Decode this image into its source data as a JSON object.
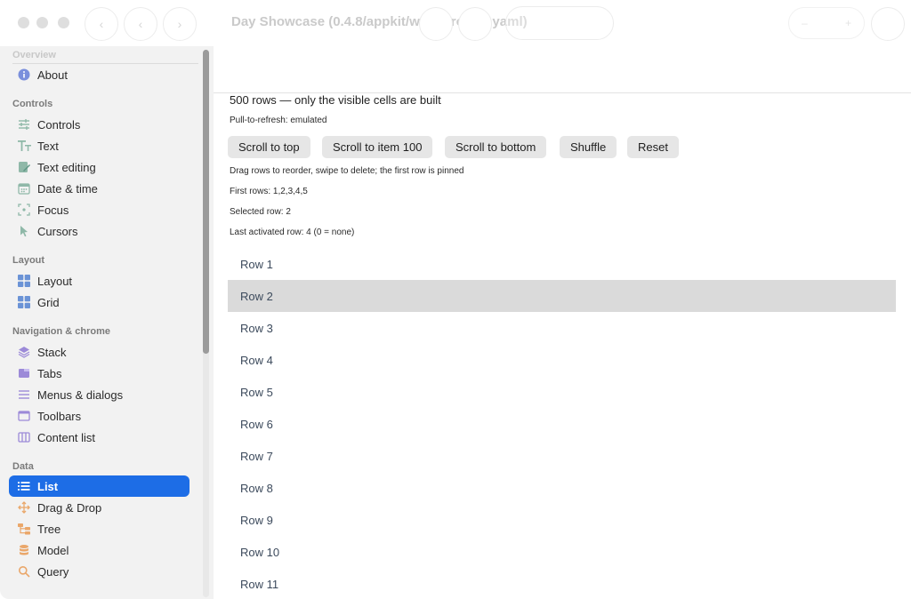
{
  "window": {
    "title": "Day Showcase (0.4.8/appkit/walkthrough.yaml)",
    "nav_back_icon": "chevron-left-icon",
    "nav_forward_icon": "chevron-right-icon"
  },
  "sidebar": {
    "overview_heading": "Overview",
    "items_overview": [
      {
        "label": "About",
        "icon": "info-icon",
        "color": "#7a8fdc"
      }
    ],
    "controls_heading": "Controls",
    "items_controls": [
      {
        "label": "Controls",
        "icon": "sliders-icon",
        "color": "#8fb8a8"
      },
      {
        "label": "Text",
        "icon": "text-size-icon",
        "color": "#8fb8a8"
      },
      {
        "label": "Text editing",
        "icon": "pencil-icon",
        "color": "#8fb8a8"
      },
      {
        "label": "Date & time",
        "icon": "calendar-icon",
        "color": "#8fb8a8"
      },
      {
        "label": "Focus",
        "icon": "focus-icon",
        "color": "#8fb8a8"
      },
      {
        "label": "Cursors",
        "icon": "cursor-icon",
        "color": "#8fb8a8"
      }
    ],
    "layout_heading": "Layout",
    "items_layout": [
      {
        "label": "Layout",
        "icon": "layout-icon",
        "color": "#6b93d6"
      },
      {
        "label": "Grid",
        "icon": "grid-icon",
        "color": "#6b93d6"
      }
    ],
    "navigation_heading": "Navigation & chrome",
    "items_navigation": [
      {
        "label": "Stack",
        "icon": "stack-icon",
        "color": "#9c8ad8"
      },
      {
        "label": "Tabs",
        "icon": "tabs-icon",
        "color": "#9c8ad8"
      },
      {
        "label": "Menus & dialogs",
        "icon": "menu-icon",
        "color": "#9c8ad8"
      },
      {
        "label": "Toolbars",
        "icon": "toolbar-icon",
        "color": "#9c8ad8"
      },
      {
        "label": "Content list",
        "icon": "columns-icon",
        "color": "#9c8ad8"
      }
    ],
    "data_heading": "Data",
    "items_data": [
      {
        "label": "List",
        "icon": "list-icon",
        "color": "#ffffff",
        "selected": true
      },
      {
        "label": "Drag & Drop",
        "icon": "move-icon",
        "color": "#eaa76a"
      },
      {
        "label": "Tree",
        "icon": "tree-icon",
        "color": "#eaa76a"
      },
      {
        "label": "Model",
        "icon": "database-icon",
        "color": "#eaa76a"
      },
      {
        "label": "Query",
        "icon": "magnifier-icon",
        "color": "#eaa76a"
      }
    ]
  },
  "main": {
    "title": "500 rows — only the visible cells are built",
    "pull_to_refresh": "Pull-to-refresh: emulated",
    "buttons": {
      "scroll_top": "Scroll to top",
      "scroll_item": "Scroll to item 100",
      "scroll_bottom": "Scroll to bottom",
      "shuffle": "Shuffle",
      "reset": "Reset"
    },
    "hint": "Drag rows to reorder, swipe to delete; the first row is pinned",
    "first_rows": "First rows: 1,2,3,4,5",
    "selected_row": "Selected row: 2",
    "last_activated": "Last activated row: 4 (0 = none)",
    "rows": [
      "Row 1",
      "Row 2",
      "Row 3",
      "Row 4",
      "Row 5",
      "Row 6",
      "Row 7",
      "Row 8",
      "Row 9",
      "Row 10",
      "Row 11"
    ],
    "selected_index": 1
  }
}
